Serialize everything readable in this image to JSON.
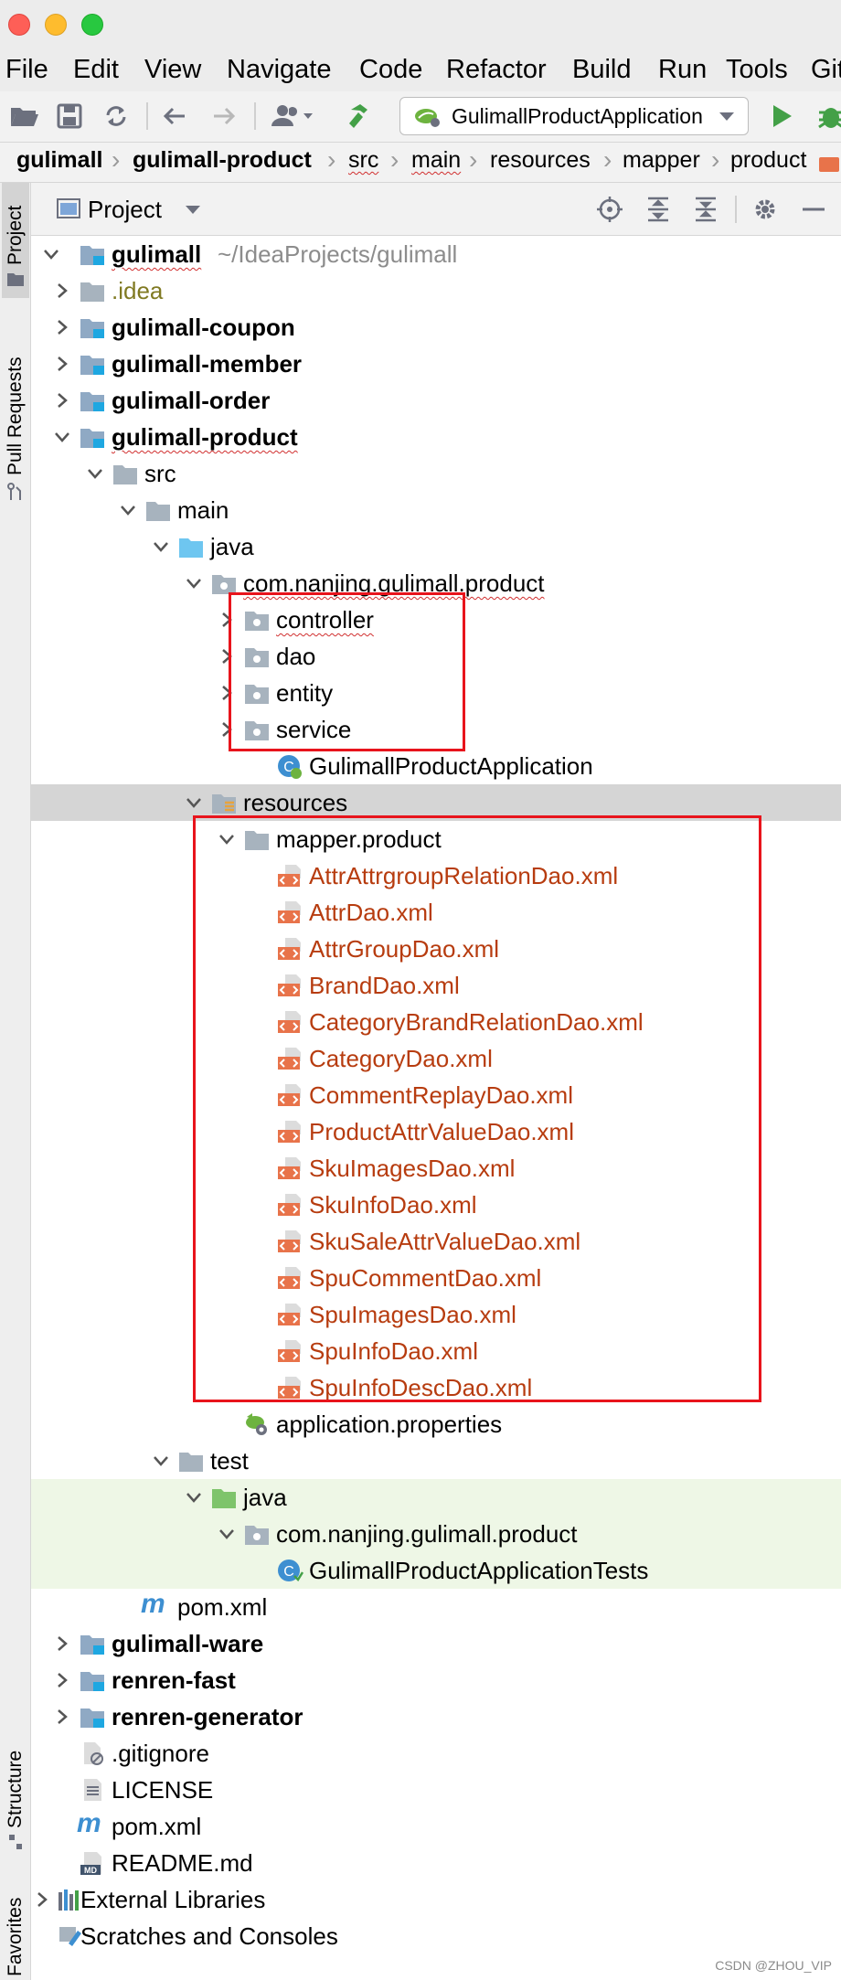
{
  "window": {
    "menu": [
      "File",
      "Edit",
      "View",
      "Navigate",
      "Code",
      "Refactor",
      "Build",
      "Run",
      "Tools",
      "Git"
    ]
  },
  "toolbar": {
    "run_config": "GulimallProductApplication"
  },
  "breadcrumb": [
    "gulimall",
    "gulimall-product",
    "src",
    "main",
    "resources",
    "mapper",
    "product"
  ],
  "left_strip": {
    "project": "Project",
    "pull_requests": "Pull Requests",
    "structure": "Structure",
    "favorites": "Favorites"
  },
  "panel": {
    "title": "Project"
  },
  "tree": {
    "root_label": "gulimall",
    "root_path": "~/IdeaProjects/gulimall",
    "idea": ".idea",
    "coupon": "gulimall-coupon",
    "member": "gulimall-member",
    "order": "gulimall-order",
    "product": "gulimall-product",
    "src": "src",
    "main": "main",
    "java": "java",
    "package": "com.nanjing.gulimall.product",
    "controller": "controller",
    "dao": "dao",
    "entity": "entity",
    "service": "service",
    "app_class": "GulimallProductApplication",
    "resources": "resources",
    "mapper": "mapper.product",
    "xml_files": [
      "AttrAttrgroupRelationDao.xml",
      "AttrDao.xml",
      "AttrGroupDao.xml",
      "BrandDao.xml",
      "CategoryBrandRelationDao.xml",
      "CategoryDao.xml",
      "CommentReplayDao.xml",
      "ProductAttrValueDao.xml",
      "SkuImagesDao.xml",
      "SkuInfoDao.xml",
      "SkuSaleAttrValueDao.xml",
      "SpuCommentDao.xml",
      "SpuImagesDao.xml",
      "SpuInfoDao.xml",
      "SpuInfoDescDao.xml"
    ],
    "app_props": "application.properties",
    "test": "test",
    "test_java": "java",
    "test_package": "com.nanjing.gulimall.product",
    "test_class": "GulimallProductApplicationTests",
    "product_pom": "pom.xml",
    "ware": "gulimall-ware",
    "renren_fast": "renren-fast",
    "renren_gen": "renren-generator",
    "gitignore": ".gitignore",
    "license": "LICENSE",
    "root_pom": "pom.xml",
    "readme": "README.md",
    "ext_libs": "External Libraries",
    "scratches": "Scratches and Consoles"
  },
  "watermark": "CSDN @ZHOU_VIP",
  "colors": {
    "highlight_box": "#e8141c",
    "xml_text": "#b73c0f",
    "selection": "#d5d5d5",
    "test_background": "#eef7e6",
    "folder": "#8fa9c4",
    "java_folder": "#6ec6f0",
    "test_folder": "#7ec46b"
  }
}
